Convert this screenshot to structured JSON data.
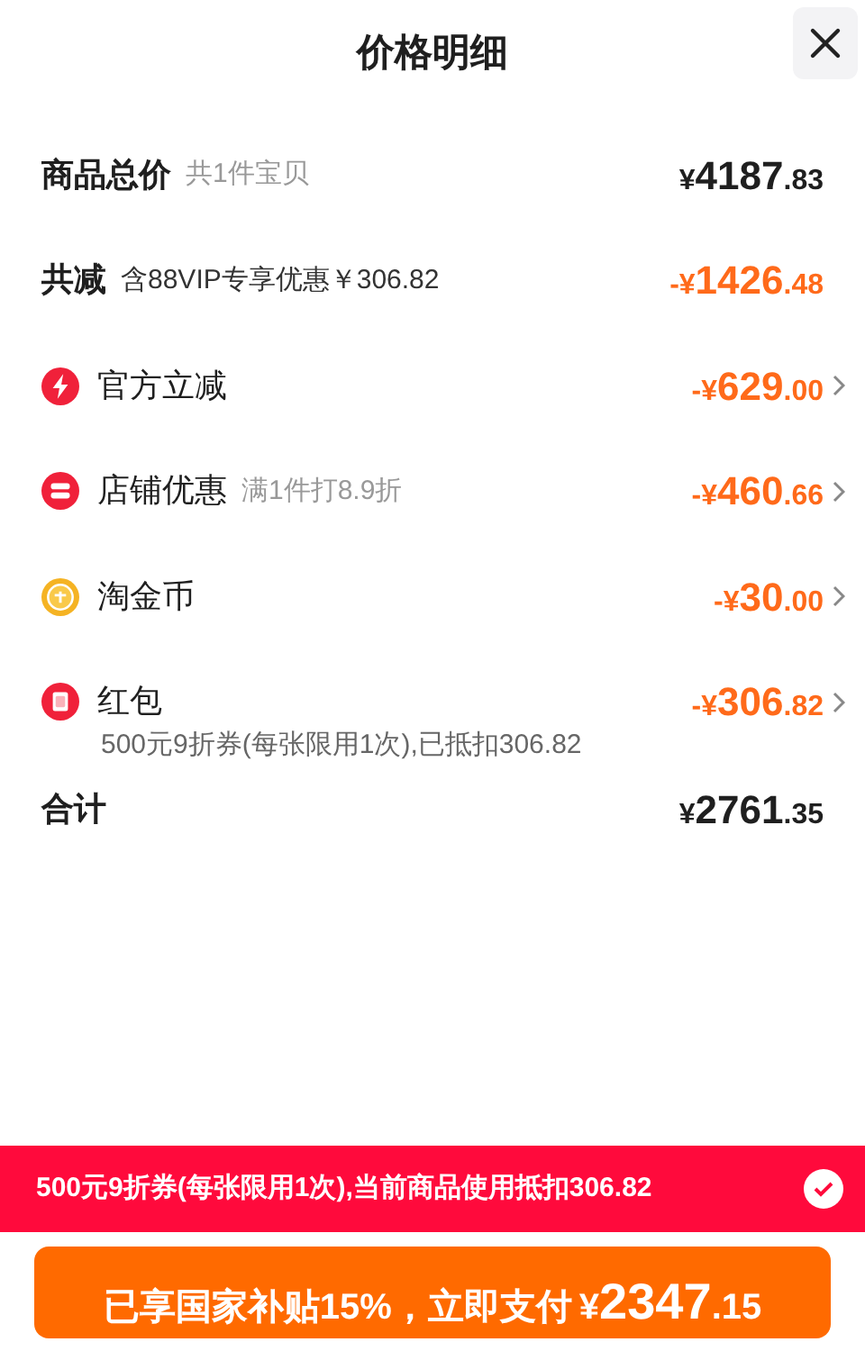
{
  "title": "价格明细",
  "rows": [
    {
      "kind": "plain",
      "label": "商品总价",
      "note": "共1件宝贝",
      "amount": {
        "sign": "¥",
        "int": "4187",
        "dec": ".83"
      },
      "discount": false
    },
    {
      "kind": "plain",
      "label": "共减",
      "note": "含88VIP专享优惠￥306.82",
      "amount": {
        "sign": "-¥",
        "int": "1426",
        "dec": ".48"
      },
      "discount": true
    },
    {
      "kind": "bolt",
      "label": "官方立减",
      "amount": {
        "sign": "-¥",
        "int": "629",
        "dec": ".00"
      },
      "discount": true
    },
    {
      "kind": "store",
      "label": "店铺优惠",
      "note": "满1件打8.9折",
      "amount": {
        "sign": "-¥",
        "int": "460",
        "dec": ".66"
      },
      "discount": true
    },
    {
      "kind": "coin",
      "label": "淘金币",
      "amount": {
        "sign": "-¥",
        "int": "30",
        "dec": ".00"
      },
      "discount": true
    },
    {
      "kind": "packet",
      "label": "红包",
      "sub": "500元9折券(每张限用1次),已抵扣306.82",
      "amount": {
        "sign": "-¥",
        "int": "306",
        "dec": ".82"
      },
      "discount": true
    },
    {
      "kind": "total",
      "label": "合计",
      "amount": {
        "sign": "¥",
        "int": "2761",
        "dec": ".35"
      },
      "discount": false
    }
  ],
  "coupon_banner": {
    "text": "500元9折券(每张限用1次),当前商品使用抵扣306.82",
    "checked": true
  },
  "pay_button": {
    "text": "已享国家补贴15%，立即支付",
    "amount": {
      "sign": "¥",
      "int": "2347",
      "dec": ".15"
    }
  }
}
